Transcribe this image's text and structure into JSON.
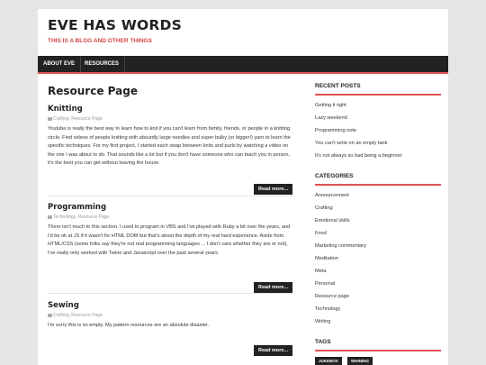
{
  "site": {
    "title": "EVE HAS WORDS",
    "tagline": "THIS IS A BLOG AND OTHER THINGS"
  },
  "nav": {
    "items": [
      {
        "label": "ABOUT EVE"
      },
      {
        "label": "RESOURCES"
      }
    ]
  },
  "page": {
    "title": "Resource Page"
  },
  "posts": [
    {
      "title": "Knitting",
      "meta": "Crafting, Resource Page",
      "body": "Youtube is really the best way to learn how to knit if you can't learn from family, friends, or people in a knitting circle. Find videos of people knitting with absurdly large needles and super bulky (or bigger!) yarn to learn the specific techniques. For my first project, I started each swap between knits and purls by watching a video on the one I was about to do. That sounds like a lot but if you don't have someone who can teach you in person, it's the best you can get without leaving the house.",
      "more": "Read more..."
    },
    {
      "title": "Programming",
      "meta": "Technology, Resource Page",
      "body": "There isn't much to this section. I used to program in VBS and I've played with Ruby a bit over the years, and I'd be ok at JS if it wasn't for HTML DOM but that's about the depth of my real hard experience. Aside from HTML/CSS (some folks say they're not real programming languages ... I don't care whether they are or not), I've really only worked with Twine and Javascript over the past several years.",
      "more": "Read more..."
    },
    {
      "title": "Sewing",
      "meta": "Crafting, Resource Page",
      "body": "I'm sorry this is so empty. My pattern resources are an absolute disaster.",
      "more": "Read more..."
    }
  ],
  "sidebar": {
    "recent": {
      "title": "RECENT POSTS",
      "items": [
        "Getting it right",
        "Lazy weekend",
        "Programming note",
        "You can't write on an empty tank",
        "It's not always so bad being a beginner"
      ]
    },
    "categories": {
      "title": "CATEGORIES",
      "items": [
        "Announcement",
        "Crafting",
        "Emotional skills",
        "Food",
        "Marketing commentary",
        "Meditation",
        "Meta",
        "Personal",
        "Resource page",
        "Technology",
        "Writing"
      ]
    },
    "tags": {
      "title": "TAGS",
      "items": [
        "JUKEBOX",
        "WHINING"
      ]
    }
  },
  "colors": {
    "accent": "#e05252",
    "nav": "#222222",
    "tagline": "#d54545"
  }
}
